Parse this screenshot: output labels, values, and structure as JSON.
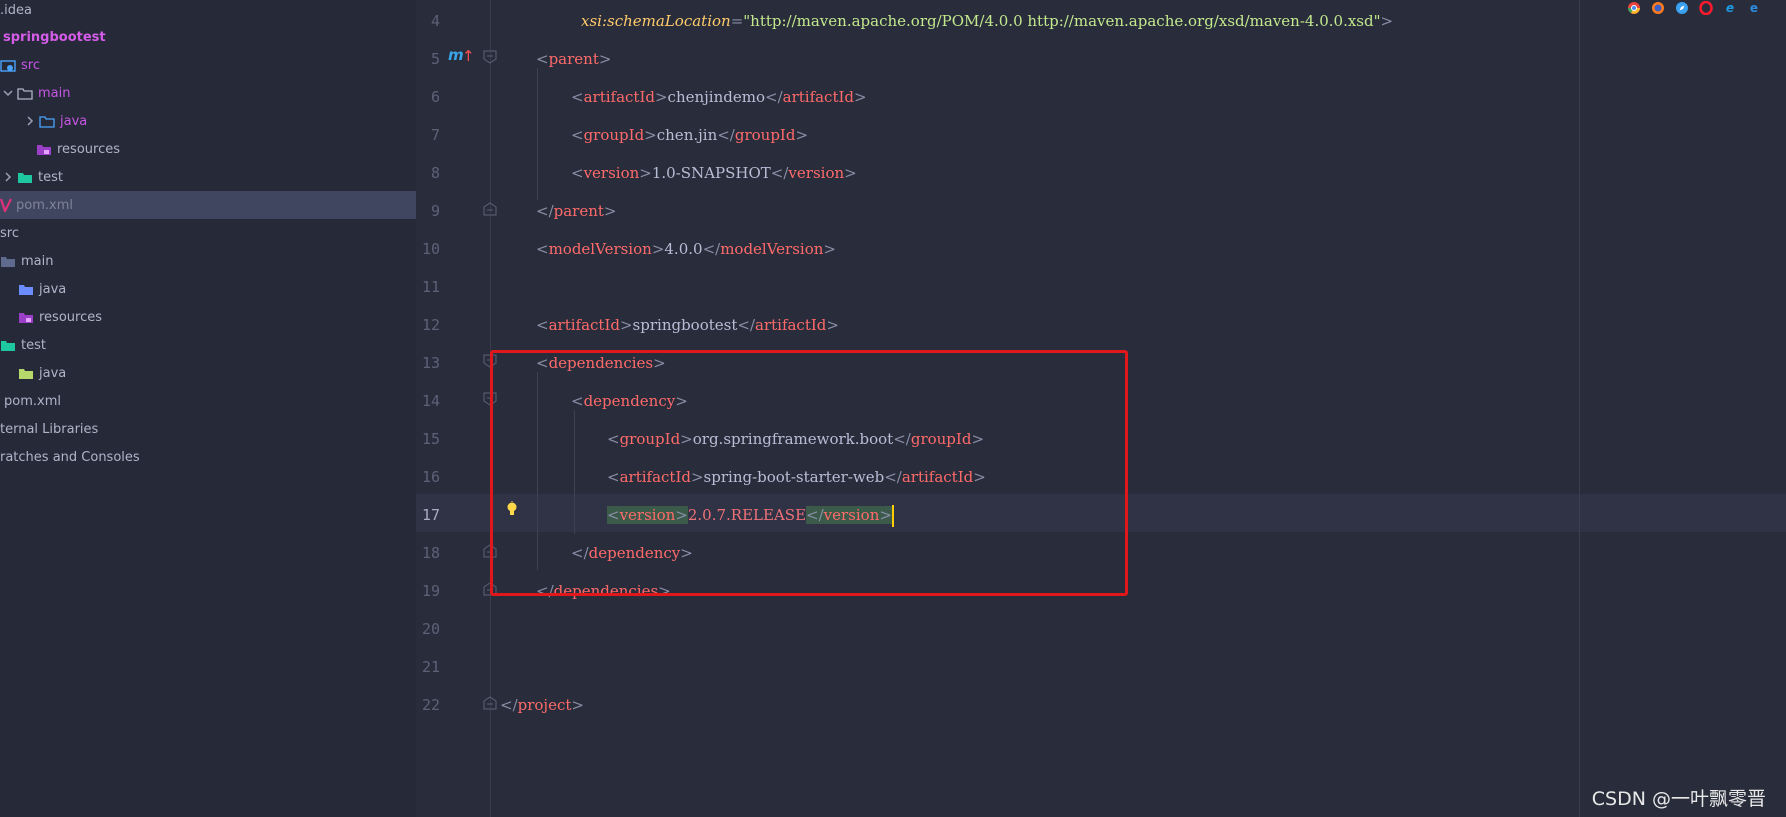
{
  "sidebar": {
    "items": [
      {
        "label": ".idea",
        "style": "plain"
      },
      {
        "label": "springbootest",
        "style": "bold"
      },
      {
        "label": "src",
        "style": "purple"
      },
      {
        "label": "main",
        "style": "purple"
      },
      {
        "label": "java",
        "style": "purple"
      },
      {
        "label": "resources",
        "style": "plain"
      },
      {
        "label": "test",
        "style": "plain"
      },
      {
        "label": "pom.xml",
        "style": "dim"
      },
      {
        "label": "src",
        "style": "plain"
      },
      {
        "label": "main",
        "style": "plain"
      },
      {
        "label": "java",
        "style": "plain"
      },
      {
        "label": "resources",
        "style": "plain"
      },
      {
        "label": "test",
        "style": "plain"
      },
      {
        "label": "java",
        "style": "plain"
      },
      {
        "label": "pom.xml",
        "style": "plain"
      },
      {
        "label": "ternal Libraries",
        "style": "plain"
      },
      {
        "label": "ratches and Consoles",
        "style": "plain"
      }
    ]
  },
  "editor": {
    "line_numbers": [
      "4",
      "5",
      "6",
      "7",
      "8",
      "9",
      "10",
      "11",
      "12",
      "13",
      "14",
      "15",
      "16",
      "17",
      "18",
      "19",
      "20",
      "21",
      "22"
    ],
    "current_line": "17",
    "code": {
      "l4_attr": "xsi",
      "l4_colon": ":",
      "l4_attrname": "schemaLocation",
      "l4_eq": "=",
      "l4_value": "\"http://maven.apache.org/POM/4.0.0 http://maven.apache.org/xsd/maven-4.0.0.xsd\"",
      "l4_close": ">",
      "parent": "parent",
      "artifactId": "artifactId",
      "groupId": "groupId",
      "version": "version",
      "modelVersion": "modelVersion",
      "dependencies": "dependencies",
      "dependency": "dependency",
      "project": "project",
      "v_chenjindemo": "chenjindemo",
      "v_chenjin": "chen.jin",
      "v_snapshot": "1.0-SNAPSHOT",
      "v_model": "4.0.0",
      "v_springbootest": "springbootest",
      "v_orgsb": "org.springframework.boot",
      "v_starter": "spring-boot-starter-web",
      "v_release": "2.0.7.RELEASE"
    }
  },
  "watermark": "CSDN @一叶飘零晋",
  "colors": {
    "highlight_box": "#e0181c",
    "tag": "#ff6a6a",
    "caret": "#ffcc00"
  },
  "icons": [
    "maven-module-icon",
    "lightbulb-icon",
    "chrome-icon",
    "firefox-icon",
    "safari-icon",
    "opera-icon",
    "ie-icon",
    "edge-icon"
  ]
}
